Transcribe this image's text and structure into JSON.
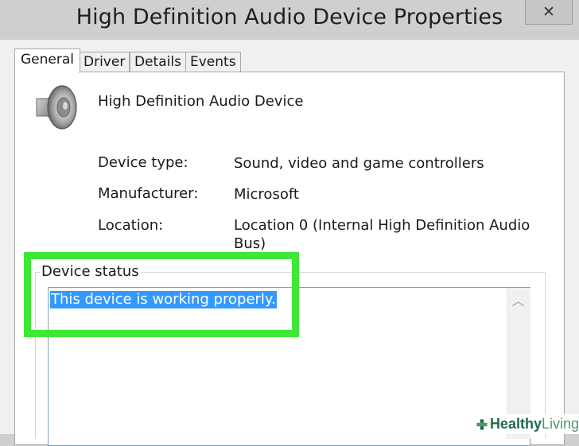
{
  "window": {
    "title": "High Definition Audio Device Properties",
    "close_label": "✕"
  },
  "tabs": [
    {
      "label": "General",
      "active": true
    },
    {
      "label": "Driver"
    },
    {
      "label": "Details"
    },
    {
      "label": "Events"
    }
  ],
  "device": {
    "icon": "speaker-icon",
    "name": "High Definition Audio Device"
  },
  "properties": [
    {
      "label": "Device type:",
      "value": "Sound, video and game controllers"
    },
    {
      "label": "Manufacturer:",
      "value": "Microsoft"
    },
    {
      "label": "Location:",
      "value": "Location 0 (Internal High Definition Audio Bus)"
    }
  ],
  "status": {
    "group_label": "Device status",
    "text": "This device is working properly.",
    "scroll_up_icon": "chevron-up-icon"
  },
  "highlight_color": "#3fe837",
  "watermark": {
    "brand_part1": "Healthy",
    "brand_part2": " Living"
  }
}
